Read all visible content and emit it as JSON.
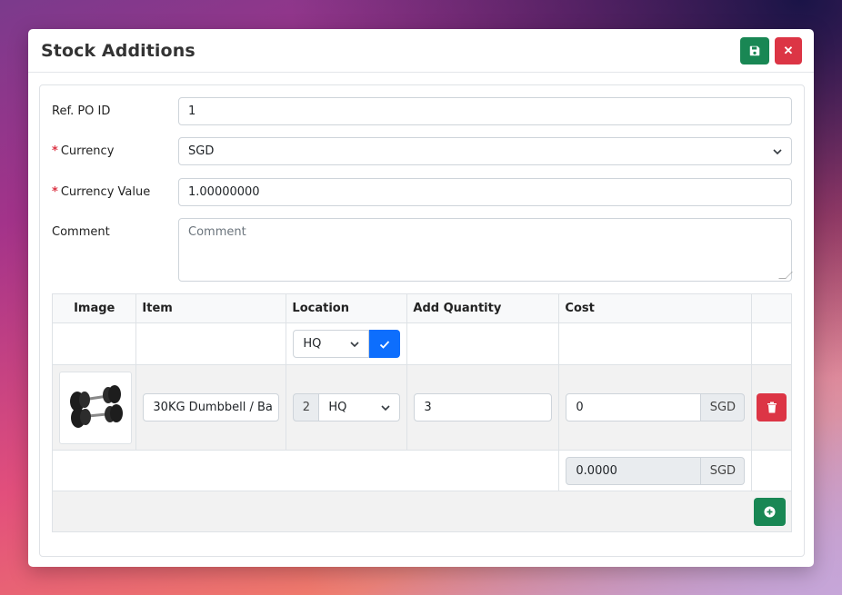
{
  "modal": {
    "title": "Stock Additions",
    "save_icon": "floppy-disk-icon",
    "close_icon": "close-icon",
    "close_glyph": "✕"
  },
  "form": {
    "ref_po": {
      "label": "Ref. PO ID",
      "value": "1"
    },
    "currency": {
      "label": "Currency",
      "required_mark": "*",
      "value": "SGD"
    },
    "currency_value": {
      "label": "Currency Value",
      "required_mark": "*",
      "value": "1.00000000"
    },
    "comment": {
      "label": "Comment",
      "placeholder": "Comment"
    }
  },
  "table": {
    "headers": {
      "image": "Image",
      "item": "Item",
      "location": "Location",
      "add_quantity": "Add Quantity",
      "cost": "Cost"
    },
    "filter": {
      "location": "HQ"
    },
    "rows": [
      {
        "image_icon": "dumbbell-product-image",
        "item": "30KG Dumbbell / Ba",
        "location_stock": "2",
        "location": "HQ",
        "quantity": "3",
        "cost": "0",
        "cost_currency": "SGD"
      }
    ],
    "total": {
      "value": "0.0000",
      "currency": "SGD"
    }
  },
  "colors": {
    "save": "#198754",
    "danger": "#dc3545",
    "primary": "#0d6efd"
  }
}
